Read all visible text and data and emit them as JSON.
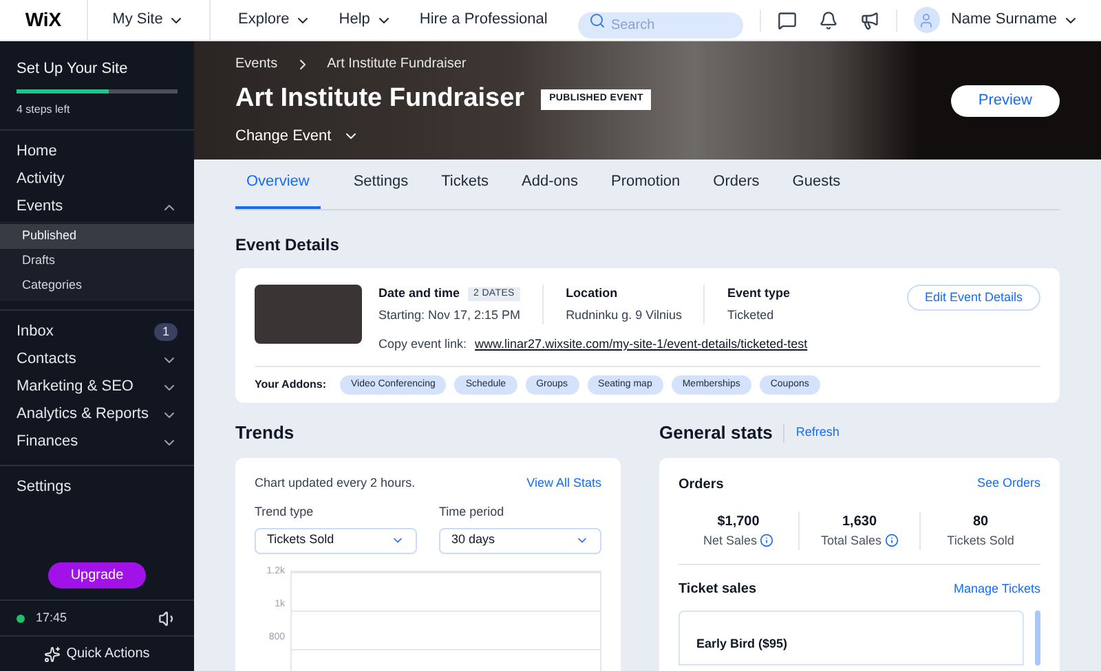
{
  "topbar": {
    "logo": "WiX",
    "site": "My Site",
    "nav": [
      {
        "label": "Explore",
        "dropdown": true
      },
      {
        "label": "Help",
        "dropdown": true
      },
      {
        "label": "Hire a Professional",
        "dropdown": false
      }
    ],
    "search": {
      "placeholder": "Search"
    },
    "user": "Name Surname"
  },
  "sidebar": {
    "setup": {
      "title": "Set Up Your Site",
      "level": 0.57,
      "steps": "4 steps left"
    },
    "sections": [
      [
        {
          "label": "Home",
          "kind": "link"
        },
        {
          "label": "Activity",
          "kind": "link"
        },
        {
          "label": "Events",
          "kind": "group",
          "expanded": true,
          "children": [
            {
              "label": "Published",
              "selected": true
            },
            {
              "label": "Drafts",
              "selected": false
            },
            {
              "label": "Categories",
              "selected": false
            }
          ]
        }
      ],
      [
        {
          "label": "Inbox",
          "kind": "badge",
          "badge": "1"
        },
        {
          "label": "Contacts",
          "kind": "group",
          "expanded": false
        },
        {
          "label": "Marketing & SEO",
          "kind": "group",
          "expanded": false
        },
        {
          "label": "Analytics & Reports",
          "kind": "group",
          "expanded": false
        },
        {
          "label": "Finances",
          "kind": "group",
          "expanded": false
        }
      ],
      [
        {
          "label": "Settings",
          "kind": "link"
        }
      ]
    ],
    "upgrade": "Upgrade",
    "time": "17:45",
    "quick_actions": "Quick Actions"
  },
  "header": {
    "breadcrumb": [
      "Events",
      "Art Institute Fundraiser"
    ],
    "title": "Art Institute Fundraiser",
    "status": "PUBLISHED EVENT",
    "change_event": "Change Event",
    "preview": "Preview"
  },
  "tabs": [
    {
      "label": "Overview",
      "selected": true
    },
    {
      "label": "Settings",
      "selected": false
    },
    {
      "label": "Tickets",
      "selected": false
    },
    {
      "label": "Add-ons",
      "selected": false
    },
    {
      "label": "Promotion",
      "selected": false
    },
    {
      "label": "Orders",
      "selected": false
    },
    {
      "label": "Guests",
      "selected": false
    }
  ],
  "event_details": {
    "title": "Event Details",
    "date": {
      "label": "Date and time",
      "badge": "2 DATES",
      "value": "Starting: Nov 17, 2:15 PM"
    },
    "location": {
      "label": "Location",
      "value": "Rudninku g. 9 Vilnius"
    },
    "type": {
      "label": "Event type",
      "value": "Ticketed"
    },
    "edit": "Edit Event Details",
    "link_label": "Copy event link:",
    "link": "www.linar27.wixsite.com/my-site-1/event-details/ticketed-test",
    "addons_label": "Your Addons:",
    "addons": [
      "Video Conferencing",
      "Schedule",
      "Groups",
      "Seating map",
      "Memberships",
      "Coupons"
    ]
  },
  "trends": {
    "title": "Trends",
    "note": "Chart updated every 2 hours.",
    "view_all": "View All Stats",
    "trend_type": {
      "label": "Trend type",
      "value": "Tickets Sold"
    },
    "time_period": {
      "label": "Time period",
      "value": "30 days"
    },
    "y_axis_labels": [
      "1.2k",
      "1k",
      "800"
    ]
  },
  "general_stats": {
    "title": "General stats",
    "refresh": "Refresh",
    "orders": {
      "title": "Orders",
      "link": "See Orders",
      "stats": [
        {
          "value": "$1,700",
          "label": "Net Sales",
          "info": true
        },
        {
          "value": "1,630",
          "label": "Total Sales",
          "info": true
        },
        {
          "value": "80",
          "label": "Tickets Sold",
          "info": false
        }
      ]
    },
    "ticket_sales": {
      "title": "Ticket sales",
      "link": "Manage Tickets",
      "tickets": [
        {
          "name": "Early Bird ($95)"
        }
      ]
    }
  }
}
